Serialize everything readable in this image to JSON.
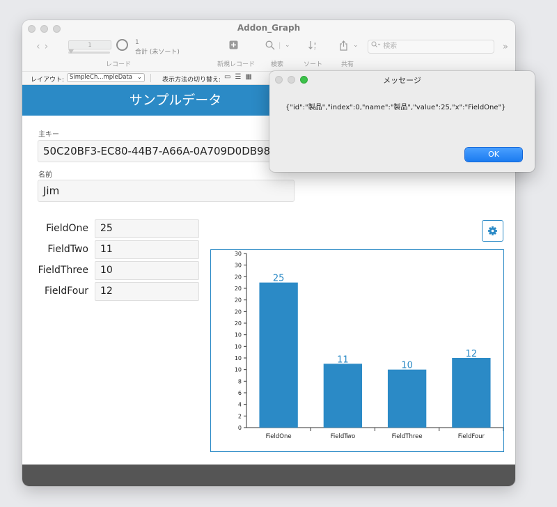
{
  "window": {
    "title": "Addon_Graph",
    "record_number": "1",
    "total_count": "1",
    "total_label": "合計 (未ソート)"
  },
  "toolbar": {
    "records_label": "レコード",
    "new_record_label": "新規レコード",
    "find_label": "検索",
    "sort_label": "ソート",
    "share_label": "共有",
    "search_placeholder": "検索"
  },
  "layout_bar": {
    "layout_label": "レイアウト:",
    "layout_value": "SimpleCh...mpleData",
    "view_as_label": "表示方法の切り替え:"
  },
  "header": {
    "title": "サンプルデータ"
  },
  "form": {
    "primary_key_label": "主キー",
    "primary_key_value": "50C20BF3-EC80-44B7-A66A-0A709D0DB988",
    "name_label": "名前",
    "name_value": "Jim",
    "fields": [
      {
        "label": "FieldOne",
        "value": "25"
      },
      {
        "label": "FieldTwo",
        "value": "11"
      },
      {
        "label": "FieldThree",
        "value": "10"
      },
      {
        "label": "FieldFour",
        "value": "12"
      }
    ]
  },
  "colors": {
    "accent": "#2b8ac6",
    "bar": "#2b8ac6",
    "footer": "#555555"
  },
  "chart_data": {
    "type": "bar",
    "categories": [
      "FieldOne",
      "FieldTwo",
      "FieldThree",
      "FieldFour"
    ],
    "values": [
      25,
      11,
      10,
      12
    ],
    "y_tick_labels": [
      "0",
      "2",
      "4",
      "6",
      "8",
      "10",
      "10",
      "10",
      "10",
      "20",
      "20",
      "20",
      "20",
      "20",
      "30",
      "30"
    ],
    "ylim": [
      0,
      30
    ],
    "grid": false
  },
  "dialog": {
    "title": "メッセージ",
    "message": "{\"id\":\"製品\",\"index\":0,\"name\":\"製品\",\"value\":25,\"x\":\"FieldOne\"}",
    "ok_label": "OK"
  }
}
